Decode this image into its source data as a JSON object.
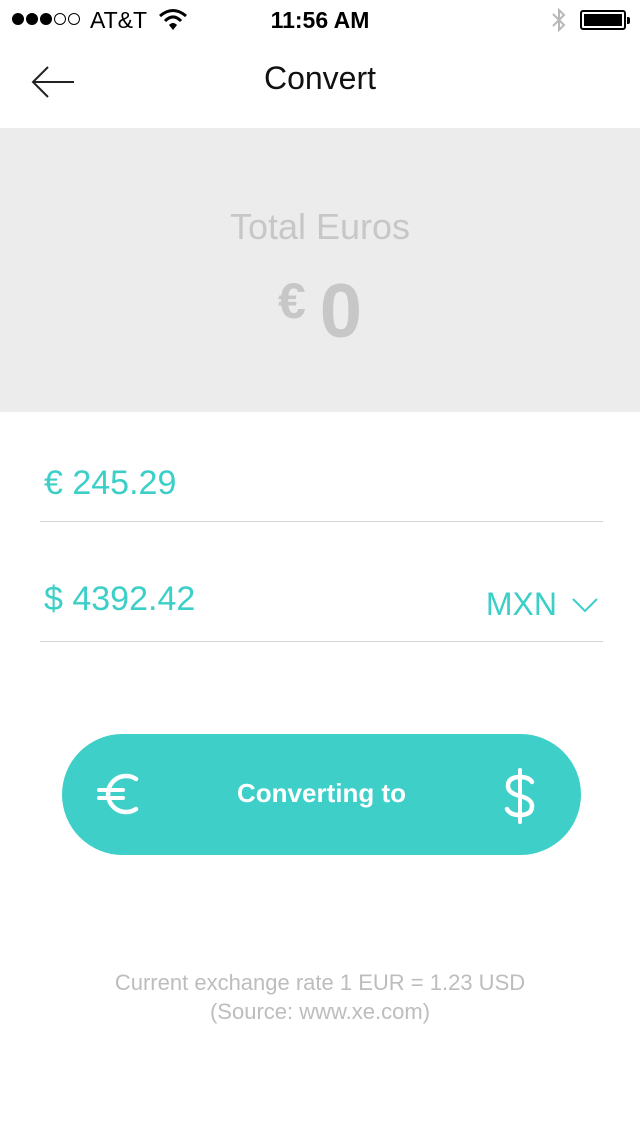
{
  "status_bar": {
    "carrier": "AT&T",
    "time": "11:56 AM"
  },
  "nav": {
    "title": "Convert",
    "back_icon": "back-arrow-icon"
  },
  "total": {
    "label": "Total Euros",
    "symbol": "€",
    "value": "0"
  },
  "inputs": {
    "euro_value": "€ 245.29",
    "dollar_value": "$ 4392.42",
    "currency": "MXN"
  },
  "convert_button": {
    "label": "Converting to",
    "from_icon": "euro-icon",
    "to_icon": "dollar-icon"
  },
  "footer": {
    "rate": "Current exchange rate 1 EUR = 1.23 USD",
    "source": "(Source: www.xe.com)"
  },
  "colors": {
    "accent": "#3ecfc9",
    "panel": "#ececec",
    "muted_text": "#c7c7c7"
  }
}
